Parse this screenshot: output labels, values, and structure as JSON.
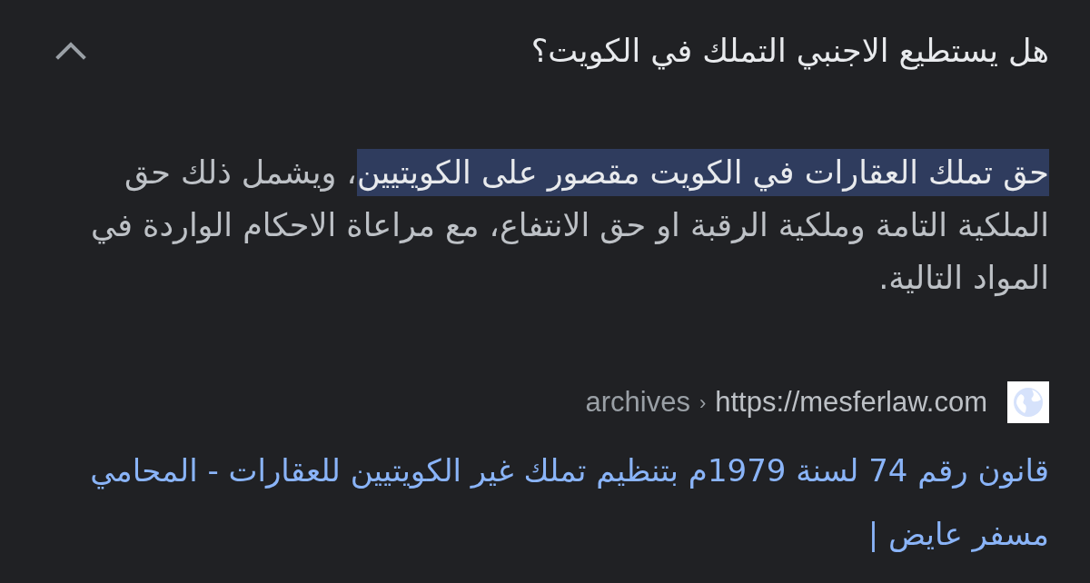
{
  "question": {
    "title": "هل يستطيع الاجنبي التملك في الكويت؟",
    "expanded": true
  },
  "answer": {
    "segments": [
      {
        "text": "حق تملك العقارات في الكويت مقصور على الكويتيين",
        "highlighted": true
      },
      {
        "text": "، ويشمل ذلك حق الملكية التامة وملكية الرقبة او حق الانتفاع، مع مراعاة الاحكام الواردة في المواد التالية.",
        "highlighted": false
      }
    ]
  },
  "source": {
    "url": "https://mesferlaw.com",
    "separator": "‹",
    "path": "archives"
  },
  "result": {
    "title": "قانون رقم 74 لسنة 1979م بتنظيم تملك غير الكويتيين للعقارات - المحامي مسفر عايض |"
  }
}
